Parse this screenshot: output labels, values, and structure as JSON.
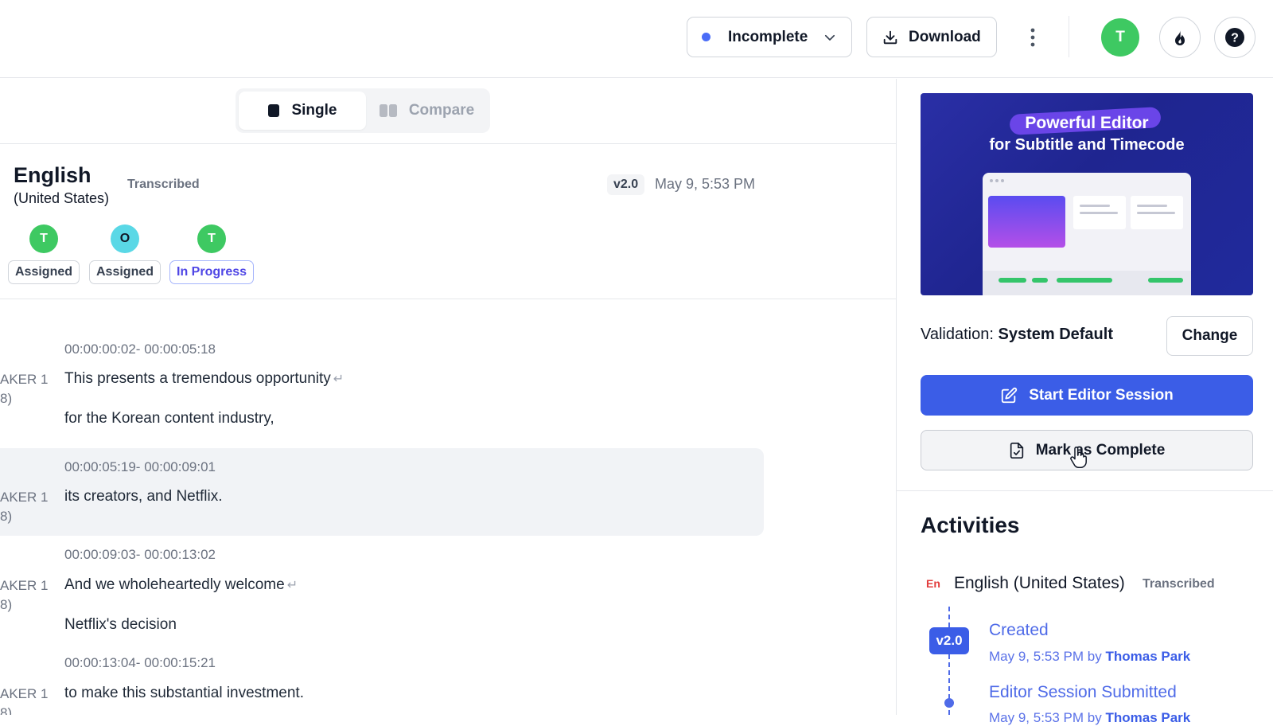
{
  "colors": {
    "accent": "#3b5de7",
    "status_dot": "#4a6cf7",
    "avatar_green": "#3ec962",
    "avatar_cyan": "#5ad8e6",
    "lang_code_red": "#e23d3d"
  },
  "header": {
    "status": {
      "label": "Incomplete",
      "icon": "chevron-down-icon"
    },
    "download_label": "Download",
    "more_icon": "more-vertical-icon",
    "user_initial": "T",
    "streak_icon": "flame-icon",
    "help_icon": "help-icon"
  },
  "view_toggle": {
    "single": "Single",
    "compare": "Compare"
  },
  "language": {
    "name": "English",
    "region": "(United States)",
    "status": "Transcribed",
    "version": "v2.0",
    "date": "May 9, 5:53 PM"
  },
  "assignees": [
    {
      "initial": "T",
      "status": "Assigned"
    },
    {
      "initial": "O",
      "status": "Assigned"
    },
    {
      "initial": "T",
      "status": "In Progress"
    }
  ],
  "segments": [
    {
      "time": "00:00:00:02- 00:00:05:18",
      "speaker_line1": "AKER 1",
      "speaker_line2": "8)",
      "lines": [
        "This presents a tremendous opportunity",
        "for the Korean content industry,"
      ]
    },
    {
      "time": "00:00:05:19- 00:00:09:01",
      "speaker_line1": "AKER 1",
      "speaker_line2": "8)",
      "lines": [
        "its creators, and Netflix."
      ]
    },
    {
      "time": "00:00:09:03- 00:00:13:02",
      "speaker_line1": "AKER 1",
      "speaker_line2": "8)",
      "lines": [
        "And we wholeheartedly welcome",
        "Netflix's decision"
      ]
    },
    {
      "time": "00:00:13:04- 00:00:15:21",
      "speaker_line1": "AKER 1",
      "speaker_line2": "8)",
      "lines": [
        "to make this substantial investment."
      ]
    }
  ],
  "promo": {
    "line1": "Powerful Editor",
    "line2": "for Subtitle and Timecode"
  },
  "validation": {
    "label": "Validation:",
    "value": "System Default",
    "change_label": "Change"
  },
  "actions": {
    "start_session": "Start Editor Session",
    "mark_complete": "Mark as Complete"
  },
  "activities": {
    "title": "Activities",
    "lang_code": "En",
    "lang_name": "English (United States)",
    "lang_status": "Transcribed",
    "version": "v2.0",
    "events": [
      {
        "title": "Created",
        "meta_prefix": "May 9, 5:53 PM by",
        "user": "Thomas Park"
      },
      {
        "title": "Editor Session Submitted",
        "meta_prefix": "May 9, 5:53 PM by",
        "user": "Thomas Park"
      }
    ]
  }
}
